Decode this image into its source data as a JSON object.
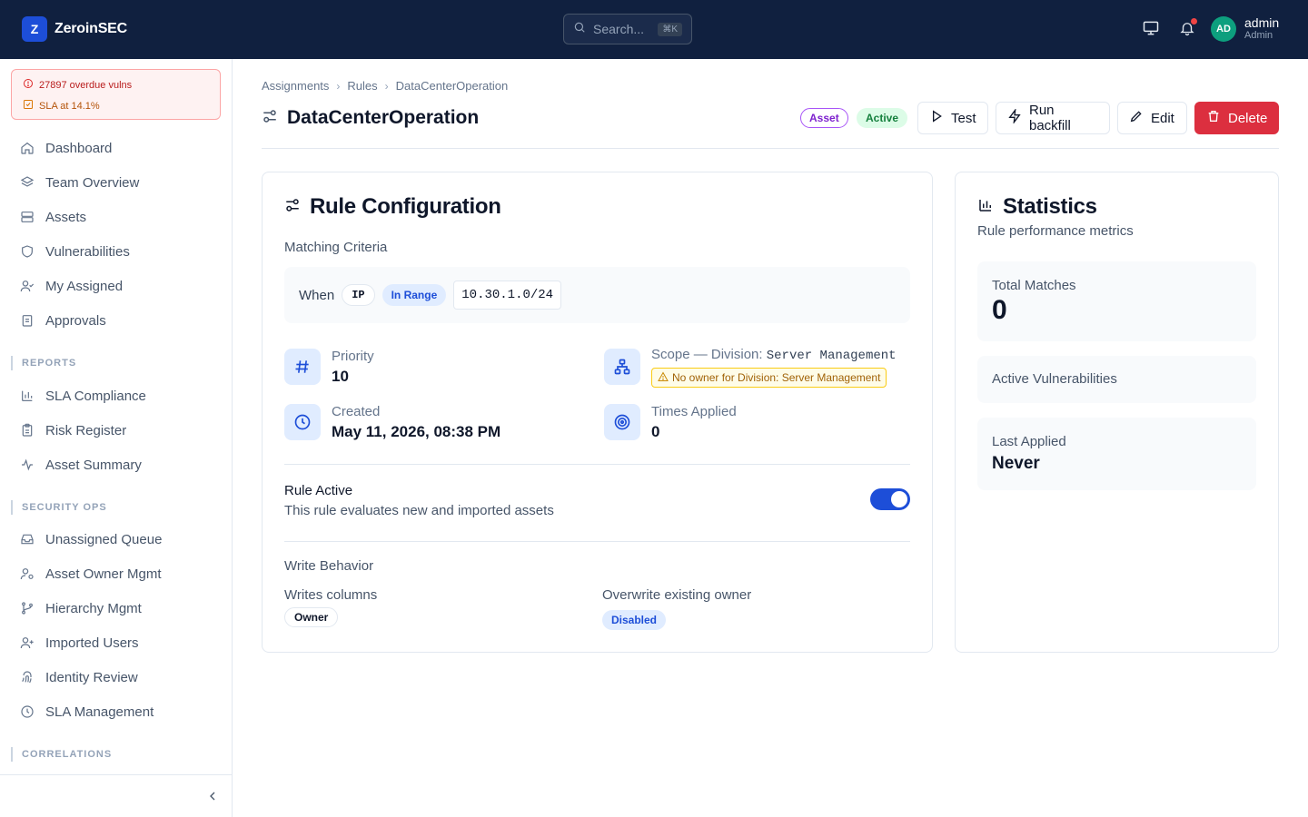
{
  "app": {
    "name": "ZeroinSEC",
    "logo_letter": "Z"
  },
  "search": {
    "placeholder": "Search...",
    "shortcut": "⌘K"
  },
  "user": {
    "initials": "AD",
    "name": "admin",
    "role": "Admin"
  },
  "alerts": {
    "overdue": "27897 overdue vulns",
    "sla": "SLA at 14.1%"
  },
  "nav": {
    "main": [
      {
        "label": "Dashboard",
        "icon": "home-icon"
      },
      {
        "label": "Team Overview",
        "icon": "layers-icon"
      },
      {
        "label": "Assets",
        "icon": "server-icon"
      },
      {
        "label": "Vulnerabilities",
        "icon": "shield-icon"
      },
      {
        "label": "My Assigned",
        "icon": "user-check-icon"
      },
      {
        "label": "Approvals",
        "icon": "clipboard-icon"
      }
    ],
    "reports_label": "REPORTS",
    "reports": [
      {
        "label": "SLA Compliance",
        "icon": "bar-chart-icon"
      },
      {
        "label": "Risk Register",
        "icon": "clipboard-list-icon"
      },
      {
        "label": "Asset Summary",
        "icon": "activity-icon"
      }
    ],
    "secops_label": "SECURITY OPS",
    "secops": [
      {
        "label": "Unassigned Queue",
        "icon": "inbox-icon"
      },
      {
        "label": "Asset Owner Mgmt",
        "icon": "user-cog-icon"
      },
      {
        "label": "Hierarchy Mgmt",
        "icon": "git-branch-icon"
      },
      {
        "label": "Imported Users",
        "icon": "user-plus-icon"
      },
      {
        "label": "Identity Review",
        "icon": "fingerprint-icon"
      },
      {
        "label": "SLA Management",
        "icon": "clock-icon"
      }
    ],
    "correlations_label": "CORRELATIONS"
  },
  "breadcrumb": [
    "Assignments",
    "Rules",
    "DataCenterOperation"
  ],
  "page": {
    "title": "DataCenterOperation",
    "badge_type": "Asset",
    "badge_status": "Active",
    "actions": {
      "test": "Test",
      "backfill": "Run backfill",
      "edit": "Edit",
      "delete": "Delete"
    }
  },
  "rule": {
    "title": "Rule Configuration",
    "matching_label": "Matching Criteria",
    "when": "When",
    "field": "IP",
    "operator": "In Range",
    "value": "10.30.1.0/24",
    "priority_label": "Priority",
    "priority": "10",
    "scope_label": "Scope — Division:",
    "scope_value": "Server Management",
    "scope_warning": "No owner for Division: Server Management",
    "created_label": "Created",
    "created": "May 11, 2026, 08:38 PM",
    "times_label": "Times Applied",
    "times": "0",
    "active_label": "Rule Active",
    "active_desc": "This rule evaluates new and imported assets",
    "active": true,
    "write_label": "Write Behavior",
    "writes_label": "Writes columns",
    "writes_value": "Owner",
    "overwrite_label": "Overwrite existing owner",
    "overwrite_value": "Disabled"
  },
  "stats": {
    "title": "Statistics",
    "subtitle": "Rule performance metrics",
    "total_label": "Total Matches",
    "total": "0",
    "active_vulns_label": "Active Vulnerabilities",
    "last_label": "Last Applied",
    "last": "Never"
  },
  "colors": {
    "topbar": "#10203f",
    "accent": "#1d4ed8",
    "danger": "#dc2f3f",
    "success": "#15803d"
  }
}
